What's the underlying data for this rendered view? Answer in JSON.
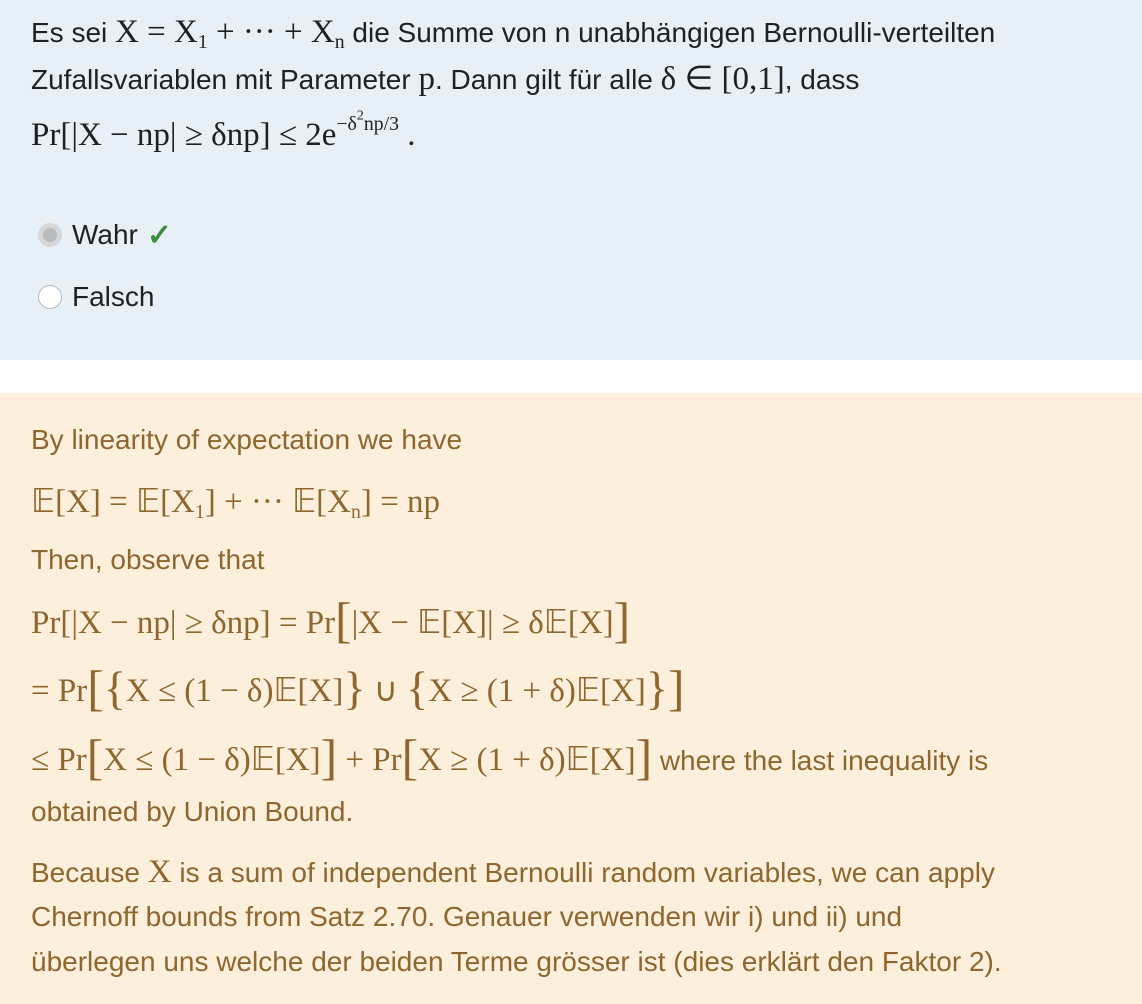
{
  "question": {
    "intro_pre": "Es sei",
    "intro_sum_mid": "die Summe von n unabhängigen Bernoulli-verteilten",
    "line2_pre": "Zufallsvariablen mit Parameter",
    "line2_mid": ". Dann gilt für alle",
    "line2_end": ", dass",
    "option_true": "Wahr",
    "option_false": "Falsch"
  },
  "feedback": {
    "p1": "By linearity of expectation we have",
    "p2": "Then, observe that",
    "p3_tail": "where the last inequality is",
    "p4": "obtained by Union Bound.",
    "p5_pre": "Because",
    "p5_post": "is a sum of independent Bernoulli random variables, we can apply",
    "p6": "Chernoff bounds from Satz 2.70. Genauer verwenden wir i) und ii) und",
    "p7": "überlegen uns welche der beiden Terme grösser ist (dies erklärt den Faktor 2)."
  },
  "colors": {
    "question_bg": "#e7eff7",
    "feedback_bg": "#fcefdc",
    "feedback_text": "#8e662e",
    "check_green": "#3a8b3a"
  },
  "icons": {
    "correct": "checkmark-icon"
  }
}
